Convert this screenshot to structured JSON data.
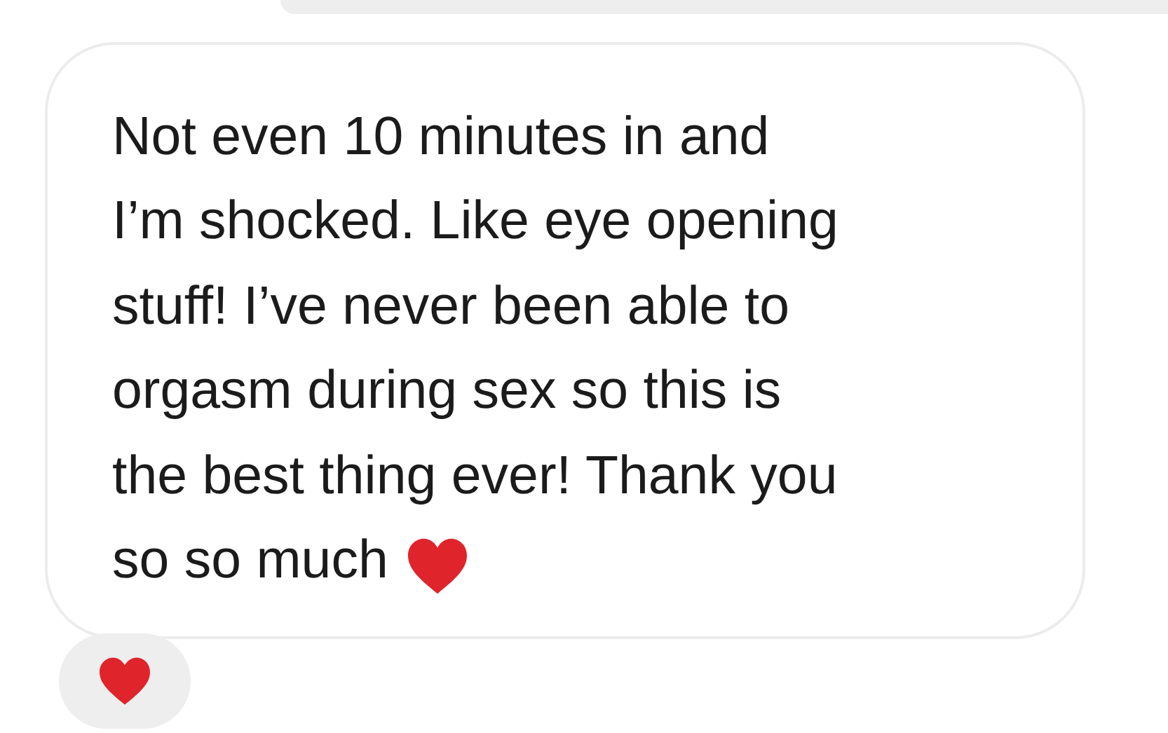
{
  "message": {
    "lines": [
      "Not even 10 minutes in and",
      "I’m shocked. Like eye opening",
      "stuff! I’ve never been able to",
      "orgasm during sex so this is",
      "the best thing ever! Thank you",
      "so so much"
    ]
  }
}
